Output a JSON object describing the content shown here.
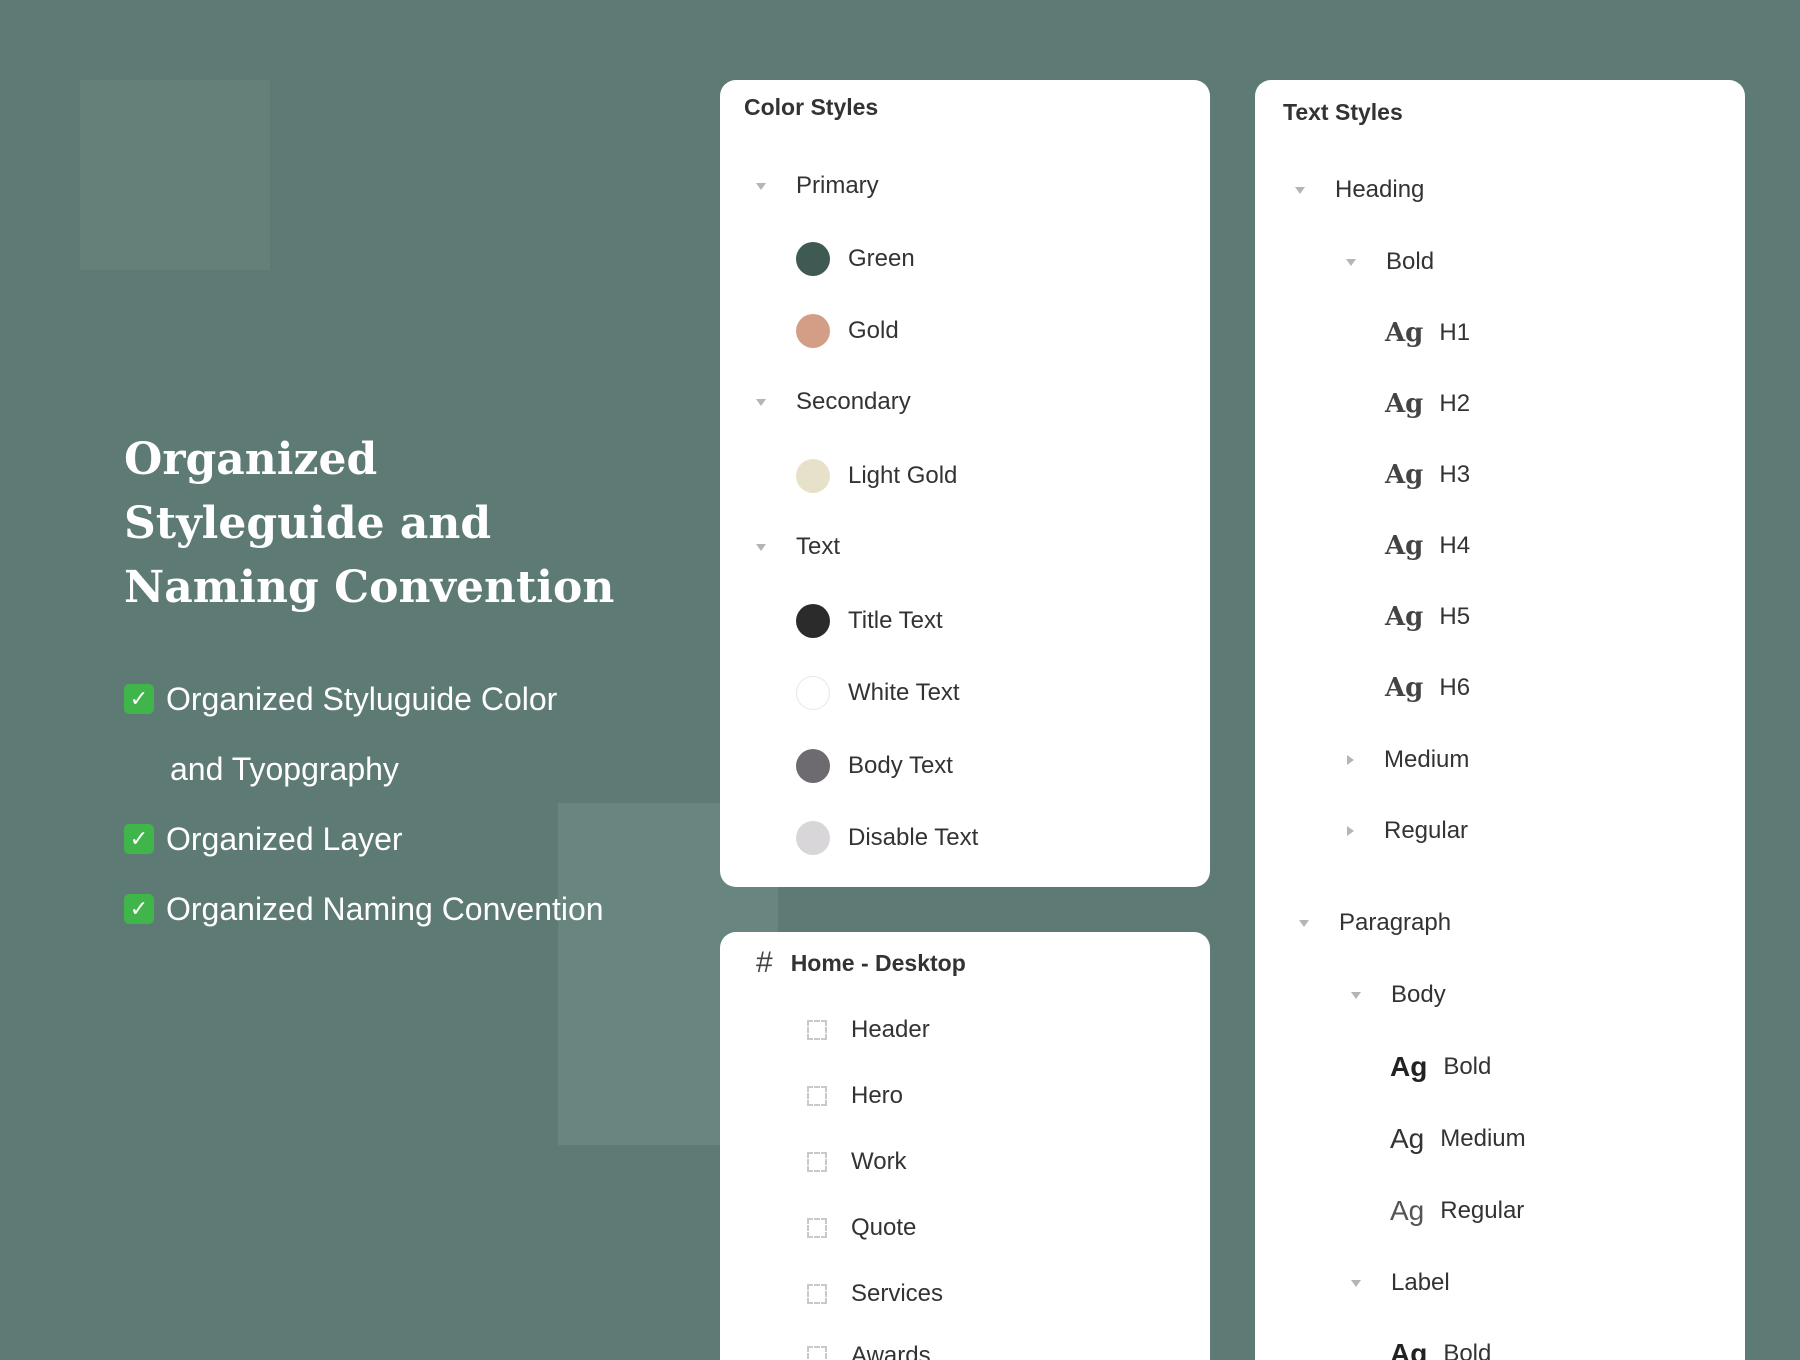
{
  "hero": {
    "title_lines": [
      "Organized",
      "Styleguide and",
      "Naming Convention"
    ]
  },
  "features": [
    {
      "lines": [
        "Organized Styluguide Color",
        "and Tyopgraphy"
      ]
    },
    {
      "lines": [
        "Organized Layer"
      ]
    },
    {
      "lines": [
        "Organized Naming Convention"
      ]
    }
  ],
  "color_styles": {
    "title": "Color Styles",
    "groups": [
      {
        "label": "Primary",
        "items": [
          {
            "label": "Green",
            "color": "#3f5a52"
          },
          {
            "label": "Gold",
            "color": "#d49d86"
          }
        ]
      },
      {
        "label": "Secondary",
        "items": [
          {
            "label": "Light Gold",
            "color": "#e7e1c9"
          }
        ]
      },
      {
        "label": "Text",
        "items": [
          {
            "label": "Title Text",
            "color": "#2b2b2b"
          },
          {
            "label": "White Text",
            "color": "#ffffff"
          },
          {
            "label": "Body Text",
            "color": "#6d6b70"
          },
          {
            "label": "Disable Text",
            "color": "#d8d6d8"
          }
        ]
      }
    ]
  },
  "layers": {
    "frame_label": "Home - Desktop",
    "items": [
      "Header",
      "Hero",
      "Work",
      "Quote",
      "Services",
      "Awards"
    ]
  },
  "text_styles": {
    "title": "Text Styles",
    "heading": {
      "label": "Heading",
      "bold_label": "Bold",
      "items": [
        "H1",
        "H2",
        "H3",
        "H4",
        "H5",
        "H6"
      ],
      "medium_label": "Medium",
      "regular_label": "Regular"
    },
    "paragraph": {
      "label": "Paragraph",
      "body_label": "Body",
      "body_items": [
        "Bold",
        "Medium",
        "Regular"
      ],
      "label_group": "Label",
      "label_items": [
        "Bold"
      ]
    },
    "sample": "Ag"
  }
}
